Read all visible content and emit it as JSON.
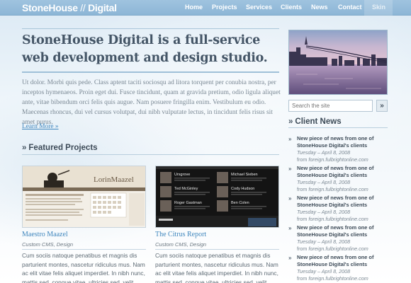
{
  "brand": {
    "logo_main": "StoneHouse",
    "logo_sep": "//",
    "logo_sub": "Digital"
  },
  "nav": {
    "items": [
      {
        "label": "Home"
      },
      {
        "label": "Projects"
      },
      {
        "label": "Services"
      },
      {
        "label": "Clients"
      },
      {
        "label": "News"
      },
      {
        "label": "Contact"
      }
    ],
    "skin_label": "Skin"
  },
  "hero": {
    "headline": "StoneHouse Digital is a full-service web development and design studio.",
    "intro": "Ut dolor. Morbi quis pede. Class aptent taciti sociosqu ad litora torquent per conubia nostra, per inceptos hymenaeos. Proin eget dui. Fusce tincidunt, quam at gravida pretium, odio ligula aliquet ante, vitae bibendum orci felis quis augue. Nam posuere fringilla enim. Vestibulum eu odio. Maecenas rhoncus, dui vel cursus volutpat, dui nibh vulputate lectus, in tincidunt felis risus sit amet purus.",
    "learn_more": "Learn More »"
  },
  "featured": {
    "heading": "Featured Projects",
    "projects": [
      {
        "title": "Maestro Maazel",
        "subtitle": "Custom CMS, Design",
        "description": "Cum sociis natoque penatibus et magnis dis parturient montes, nascetur ridiculus mus. Nam ac elit vitae felis aliquet imperdiet. In nibh nunc, mattis sed, congue vitae, ultricies sed, velit. Maecenas",
        "thumb_logo": "LorinMaazel"
      },
      {
        "title": "The Citrus Report",
        "subtitle": "Custom CMS, Design",
        "description": "Cum sociis natoque penatibus et magnis dis parturient montes, nascetur ridiculus mus. Nam ac elit vitae felis aliquet imperdiet. In nibh nunc, mattis sed, congue vitae, ultricies sed, velit. Maecenas",
        "thumb_names": [
          "Ursgrove",
          "Michael Sieben",
          "Ted McGinley",
          "Cody Hudson",
          "Roger Gastman",
          "Ben Colen"
        ]
      }
    ]
  },
  "sidebar": {
    "search_placeholder": "Search the site",
    "search_button": "»",
    "news_heading": "Client News",
    "news": [
      {
        "title": "New piece of news from one of StoneHouse Digital's clients",
        "date": "Tuesday – April 8, 2008",
        "from_label": "from",
        "source": "foreign.fulbrightonline.com"
      },
      {
        "title": "New piece of news from one of StoneHouse Digital's clients",
        "date": "Tuesday – April 8, 2008",
        "from_label": "from",
        "source": "foreign.fulbrightonline.com"
      },
      {
        "title": "New piece of news from one of StoneHouse Digital's clients",
        "date": "Tuesday – April 8, 2008",
        "from_label": "from",
        "source": "foreign.fulbrightonline.com"
      },
      {
        "title": "New piece of news from one of StoneHouse Digital's clients",
        "date": "Tuesday – April 8, 2008",
        "from_label": "from",
        "source": "foreign.fulbrightonline.com"
      },
      {
        "title": "New piece of news from one of StoneHouse Digital's clients",
        "date": "Tuesday – April 8, 2008",
        "from_label": "from",
        "source": "foreign.fulbrightonline.com"
      }
    ]
  },
  "colors": {
    "nav_bg": "#8db6d6",
    "link": "#3f86bd",
    "heading": "#3d4b58",
    "text": "#5d6a74"
  }
}
